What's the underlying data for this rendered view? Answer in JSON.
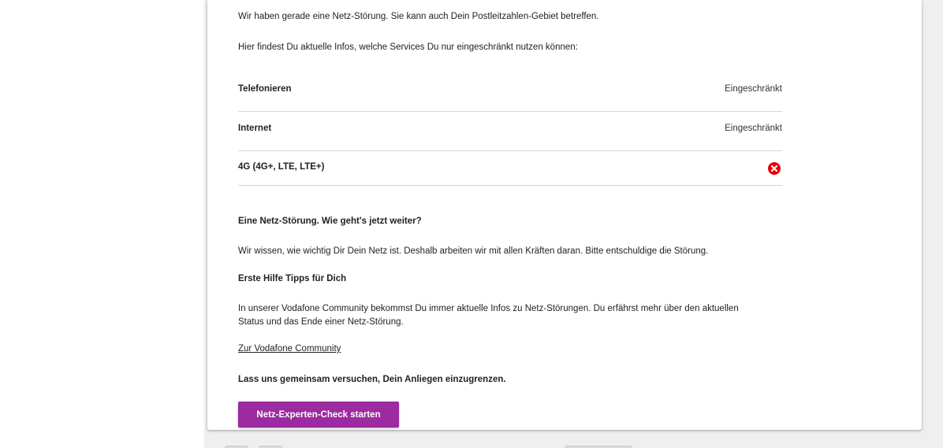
{
  "outage": {
    "intro": "Wir haben gerade eine Netz-Störung. Sie kann auch Dein Postleitzahlen-Gebiet betreffen.",
    "info": "Hier findest Du aktuelle Infos, welche Services Du nur eingeschränkt nutzen können:",
    "services": [
      {
        "label": "Telefonieren",
        "status": "Eingeschränkt"
      },
      {
        "label": "Internet",
        "status": "Eingeschränkt"
      },
      {
        "label": "4G (4G+, LTE, LTE+)",
        "status_icon": "error-icon"
      }
    ]
  },
  "next_steps": {
    "heading": "Eine Netz-Störung. Wie geht's jetzt weiter?",
    "text": "Wir wissen, wie wichtig Dir Dein Netz ist. Deshalb arbeiten wir mit allen Kräften daran. Bitte entschuldige die Störung.",
    "tips_heading": "Erste Hilfe Tipps für Dich",
    "tips_text_line1": "In unserer Vodafone Community bekommst Du immer aktuelle Infos zu Netz-Störungen. Du erfährst mehr über den aktuellen",
    "tips_text_line2": "Status und das Ende einer Netz-Störung.",
    "community_link": "Zur Vodafone Community",
    "narrow_down": "Lass uns gemeinsam versuchen, Dein Anliegen einzugrenzen.",
    "cta_label": "Netz-Experten-Check starten"
  },
  "colors": {
    "brand": "#9c2aa0",
    "error": "#e60000"
  }
}
